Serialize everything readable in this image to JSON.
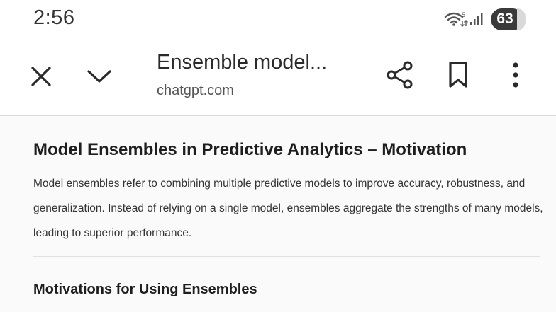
{
  "status_bar": {
    "time": "2:56",
    "wifi_icon": "wifi-icon",
    "signal_icon": "signal-bars-icon",
    "battery_level": "63"
  },
  "toolbar": {
    "close_icon": "close-icon",
    "chevron_icon": "chevron-down-icon",
    "title": "Ensemble model...",
    "domain": "chatgpt.com",
    "share_icon": "share-icon",
    "bookmark_icon": "bookmark-icon",
    "more_icon": "more-vertical-icon"
  },
  "article": {
    "heading": "Model Ensembles in Predictive Analytics – Motivation",
    "body": "Model ensembles refer to combining multiple predictive models to improve accuracy, robustness, and generalization. Instead of relying on a single model, ensembles aggregate the strengths of many models, leading to superior performance.",
    "section_heading": "Motivations for Using Ensembles"
  }
}
